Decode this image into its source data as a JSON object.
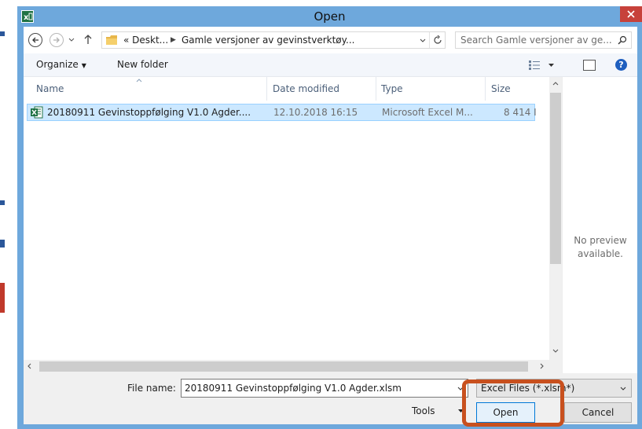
{
  "window": {
    "title": "Open"
  },
  "nav": {
    "path": [
      "« Deskt...",
      "Gamle versjoner av gevinstverktøy..."
    ],
    "search_placeholder": "Search Gamle versjoner av ge..."
  },
  "toolbar": {
    "organize": "Organize",
    "new_folder": "New folder"
  },
  "columns": {
    "name": "Name",
    "date": "Date modified",
    "type": "Type",
    "size": "Size"
  },
  "files": [
    {
      "name": "20180911 Gevinstoppfølging V1.0 Agder....",
      "date": "12.10.2018 16:15",
      "type": "Microsoft Excel M...",
      "size": "8 414 I"
    }
  ],
  "preview": {
    "line1": "No preview",
    "line2": "available."
  },
  "bottom": {
    "file_name_label": "File name:",
    "file_name_value": "20180911 Gevinstoppfølging V1.0 Agder.xlsm",
    "filter_value": "Excel Files (*.xlsm*)",
    "tools_label": "Tools",
    "open_label": "Open",
    "cancel_label": "Cancel"
  },
  "colors": {
    "title_bar": "#6ea8dc",
    "close_button": "#c7413a",
    "selection": "#cce8ff",
    "highlight_box": "#c8501e",
    "excel_green": "#1f7244"
  },
  "icons": [
    "excel-icon",
    "close-icon",
    "back-arrow-icon",
    "forward-arrow-icon",
    "up-arrow-icon",
    "folder-icon",
    "refresh-icon",
    "search-icon",
    "view-options-icon",
    "preview-pane-icon",
    "help-icon",
    "excel-file-icon"
  ]
}
